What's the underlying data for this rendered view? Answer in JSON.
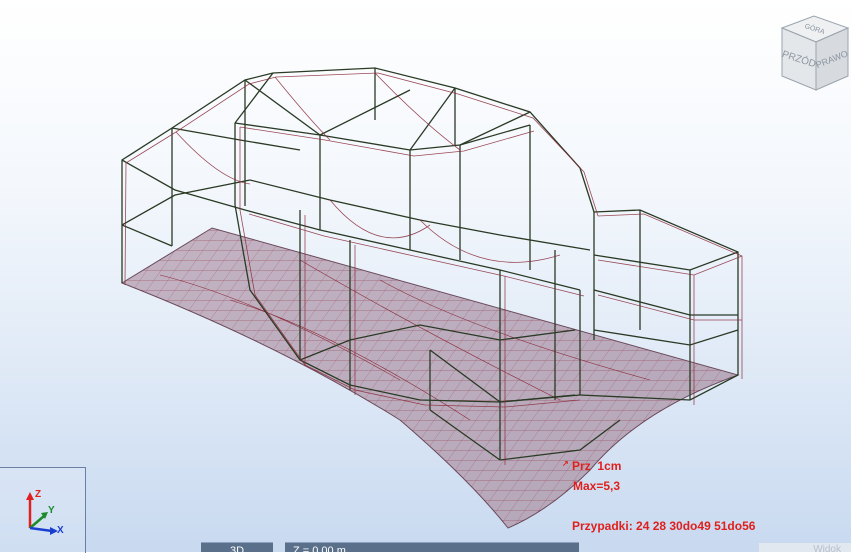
{
  "viewcube": {
    "top": "GÓRA",
    "front": "PRZÓD",
    "right": "PRAWO"
  },
  "axes": {
    "z": "Z",
    "y": "Y",
    "x": "X"
  },
  "result": {
    "component": "Prz",
    "unit": "1cm",
    "max": "Max=5,3",
    "cases": "Przypadki: 24 28 30do49 51do56"
  },
  "bottom_tabs": {
    "view": "3D",
    "level": "Z = 0.00 m",
    "right": "Widok"
  },
  "colors": {
    "frame": "#2a3a24",
    "mesh": "#8a2a3a",
    "slab": "#b9a9b9",
    "result": "#e0201c"
  }
}
